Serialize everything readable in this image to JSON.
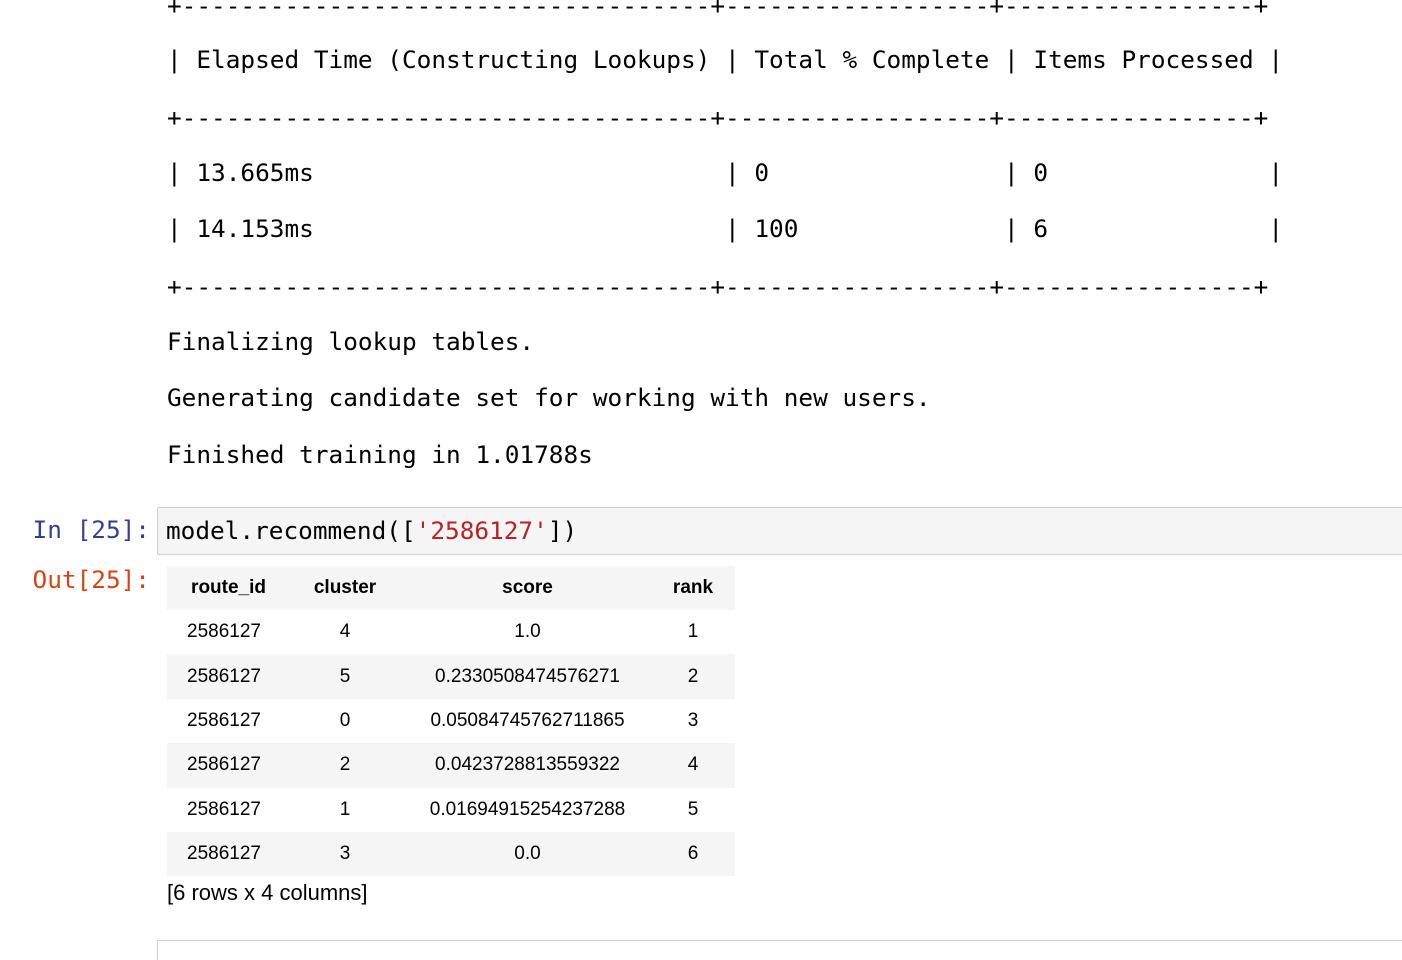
{
  "output": {
    "table_border": "+------------------------------------+------------------+-----------------+",
    "header_row": "| Elapsed Time (Constructing Lookups) | Total % Complete | Items Processed |",
    "progress_rows": [
      "| 13.665ms                            | 0                | 0               |",
      "| 14.153ms                            | 100              | 6               |"
    ],
    "messages": [
      "Finalizing lookup tables.",
      "Generating candidate set for working with new users.",
      "Finished training in 1.01788s"
    ]
  },
  "cell": {
    "in_prompt": "In [25]:",
    "out_prompt": "Out[25]:",
    "code_prefix": "model.recommend([",
    "code_string": "'2586127'",
    "code_suffix": "])"
  },
  "dataframe": {
    "columns": [
      "route_id",
      "cluster",
      "score",
      "rank"
    ],
    "rows": [
      [
        "2586127",
        "4",
        "1.0",
        "1"
      ],
      [
        "2586127",
        "5",
        "0.2330508474576271",
        "2"
      ],
      [
        "2586127",
        "0",
        "0.05084745762711865",
        "3"
      ],
      [
        "2586127",
        "2",
        "0.0423728813559322",
        "4"
      ],
      [
        "2586127",
        "1",
        "0.01694915254237288",
        "5"
      ],
      [
        "2586127",
        "3",
        "0.0",
        "6"
      ]
    ],
    "summary": "[6 rows x 4 columns]"
  }
}
